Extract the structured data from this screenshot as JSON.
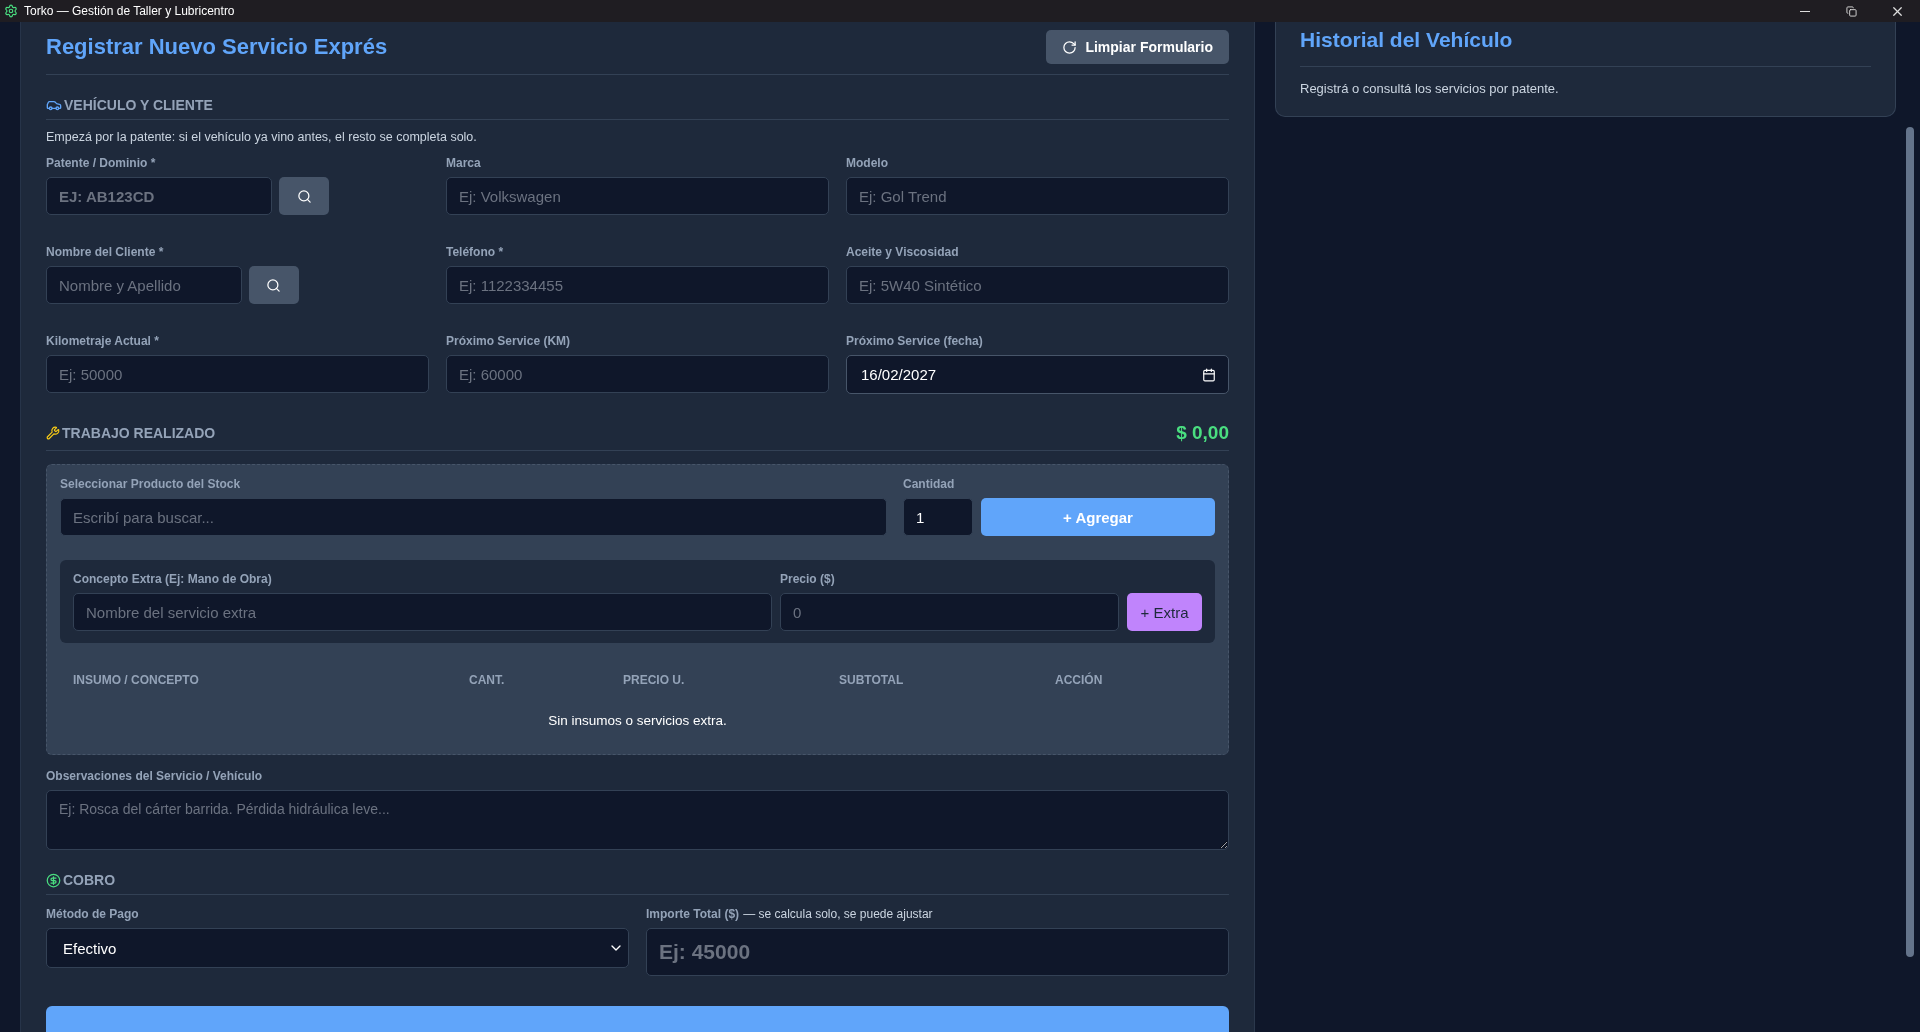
{
  "window": {
    "title": "Torko — Gestión de Taller y Lubricentro"
  },
  "form": {
    "title": "Registrar Nuevo Servicio Exprés",
    "clear_button": "Limpiar Formulario",
    "vehicle_section": {
      "heading": "VEHÍCULO Y CLIENTE",
      "hint": "Empezá por la patente: si el vehículo ya vino antes, el resto se completa solo.",
      "fields": [
        {
          "label": "Patente / Dominio *",
          "placeholder": "EJ: AB123CD",
          "kind": "search"
        },
        {
          "label": "Marca",
          "placeholder": "Ej: Volkswagen",
          "kind": "text"
        },
        {
          "label": "Modelo",
          "placeholder": "Ej: Gol Trend",
          "kind": "text"
        },
        {
          "label": "Nombre del Cliente *",
          "placeholder": "Nombre y Apellido",
          "kind": "search"
        },
        {
          "label": "Teléfono *",
          "placeholder": "Ej: 1122334455",
          "kind": "text"
        },
        {
          "label": "Aceite y Viscosidad",
          "placeholder": "Ej: 5W40 Sintético",
          "kind": "text"
        },
        {
          "label": "Kilometraje Actual *",
          "placeholder": "Ej: 50000",
          "kind": "text"
        },
        {
          "label": "Próximo Service (KM)",
          "placeholder": "Ej: 60000",
          "kind": "text"
        },
        {
          "label": "Próximo Service (fecha)",
          "value": "16/02/2027",
          "kind": "date"
        }
      ]
    },
    "work_section": {
      "heading": "TRABAJO REALIZADO",
      "total": "$ 0,00",
      "product_label": "Seleccionar Producto del Stock",
      "product_placeholder": "Escribí para buscar...",
      "quantity_label": "Cantidad",
      "quantity_value": "1",
      "add_button": "+ Agregar",
      "extra_label": "Concepto Extra (Ej: Mano de Obra)",
      "extra_placeholder": "Nombre del servicio extra",
      "price_label": "Precio ($)",
      "price_placeholder": "0",
      "extra_button": "+ Extra",
      "table": {
        "columns": [
          "INSUMO / CONCEPTO",
          "CANT.",
          "PRECIO U.",
          "SUBTOTAL",
          "ACCIÓN"
        ],
        "empty": "Sin insumos o servicios extra."
      }
    },
    "notes": {
      "label": "Observaciones del Servicio / Vehículo",
      "placeholder": "Ej: Rosca del cárter barrida. Pérdida hidráulica leve..."
    },
    "payment_section": {
      "heading": "COBRO",
      "method_label": "Método de Pago",
      "method_value": "Efectivo",
      "amount_label": "Importe Total ($)",
      "amount_note": "— se calcula solo, se puede ajustar",
      "amount_placeholder": "Ej: 45000"
    }
  },
  "history": {
    "title": "Historial del Vehículo",
    "text": "Registrá o consultá los servicios por patente."
  }
}
